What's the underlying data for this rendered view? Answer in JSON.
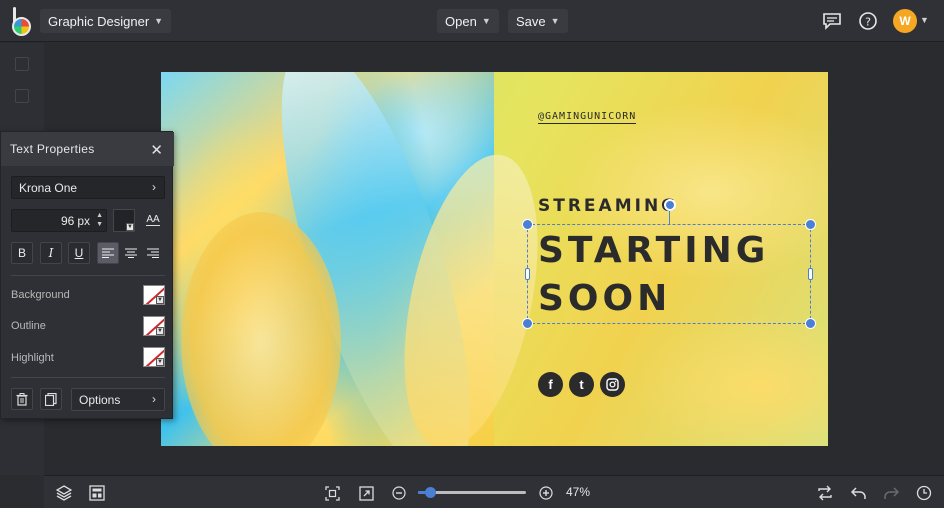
{
  "topbar": {
    "project_label": "Graphic Designer",
    "open_label": "Open",
    "save_label": "Save",
    "avatar_initial": "W"
  },
  "panel": {
    "title": "Text Properties",
    "font_name": "Krona One",
    "font_size": "96",
    "font_unit": "px",
    "case_toggle": "AA",
    "bold": "B",
    "italic": "I",
    "underline": "U",
    "background_label": "Background",
    "outline_label": "Outline",
    "highlight_label": "Highlight",
    "options_label": "Options",
    "alignment_selected": "left"
  },
  "design": {
    "handle": "@GAMINGUNICORN",
    "line1": "STREAMING",
    "line2": "STARTING",
    "line3": "SOON",
    "social_facebook": "f",
    "social_tumblr": "t"
  },
  "zoom": {
    "percent_label": "47%",
    "value": 0.12
  },
  "colors": {
    "accent": "#4a7fd4",
    "avatar": "#f5a623",
    "text_dark": "#2b2b2b"
  }
}
